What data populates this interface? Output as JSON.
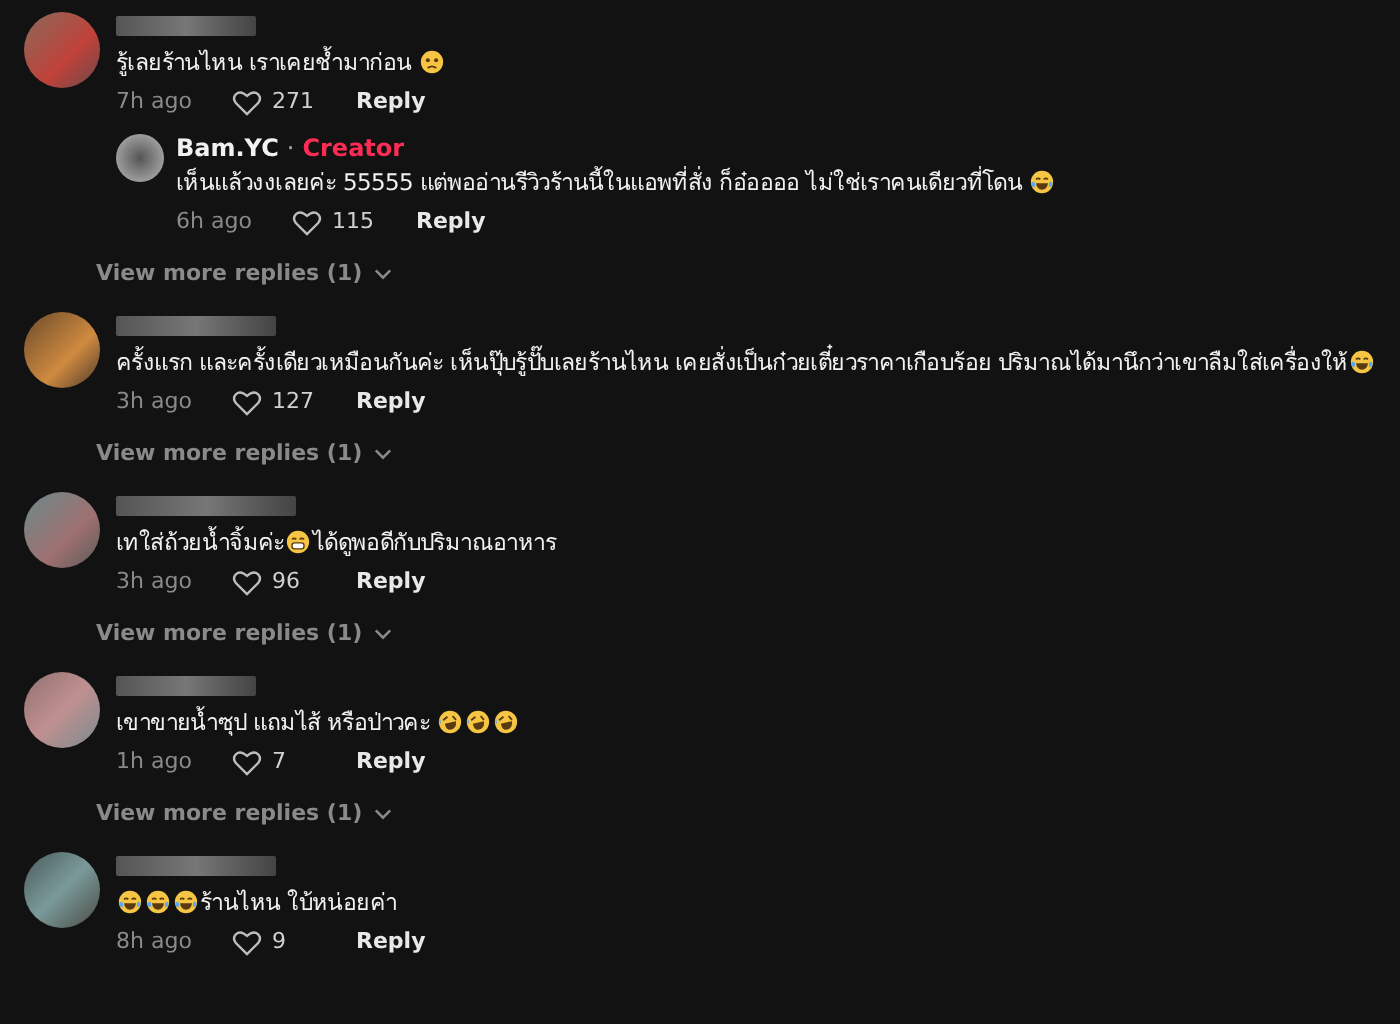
{
  "comments": [
    {
      "parts": [
        {
          "kind": "text",
          "text": "รู้เลยร้านไหน เราเคยช้ำมาก่อน "
        },
        {
          "kind": "sad"
        }
      ],
      "time": "7h ago",
      "likes": "271",
      "reply": "Reply",
      "replies": [
        {
          "author": "Bam.YC",
          "separator": "·",
          "badge": "Creator",
          "parts": [
            {
              "kind": "text",
              "text": "เห็นแล้วงงเลยค่ะ 55555 แต่พออ่านรีวิวร้านนี้ในแอพที่สั่ง ก็อ๋ออออ ไม่ใช่เราคนเดียวที่โดน "
            },
            {
              "kind": "tears"
            }
          ],
          "time": "6h ago",
          "likes": "115",
          "reply": "Reply"
        }
      ],
      "view_more": "View more replies (1)"
    },
    {
      "parts": [
        {
          "kind": "text",
          "text": "ครั้งแรก และครั้งเดียวเหมือนกันค่ะ เห็นปุ๊บรู้ปั๊บเลยร้านไหน เคยสั่งเป็นก๋วยเตี๋ยวราคาเกือบร้อย ปริมาณได้มานึกว่าเขาลืมใส่เครื่องให้"
        },
        {
          "kind": "tears"
        }
      ],
      "time": "3h ago",
      "likes": "127",
      "reply": "Reply",
      "view_more": "View more replies (1)"
    },
    {
      "parts": [
        {
          "kind": "text",
          "text": "เทใส่ถ้วยน้ำจิ้มค่ะ"
        },
        {
          "kind": "grin"
        },
        {
          "kind": "text",
          "text": "ได้ดูพอดีกับปริมาณอาหาร"
        }
      ],
      "time": "3h ago",
      "likes": "96",
      "reply": "Reply",
      "view_more": "View more replies (1)"
    },
    {
      "parts": [
        {
          "kind": "text",
          "text": "เขาขายน้ำซุป แถมไส้ หรือป่าวคะ "
        },
        {
          "kind": "rofl"
        },
        {
          "kind": "rofl"
        },
        {
          "kind": "rofl"
        }
      ],
      "time": "1h ago",
      "likes": "7",
      "reply": "Reply",
      "view_more": "View more replies (1)"
    },
    {
      "parts": [
        {
          "kind": "tears"
        },
        {
          "kind": "tears"
        },
        {
          "kind": "tears"
        },
        {
          "kind": "text",
          "text": "ร้านไหน ใบ้หน่อยค่า"
        }
      ],
      "time": "8h ago",
      "likes": "9",
      "reply": "Reply"
    }
  ]
}
